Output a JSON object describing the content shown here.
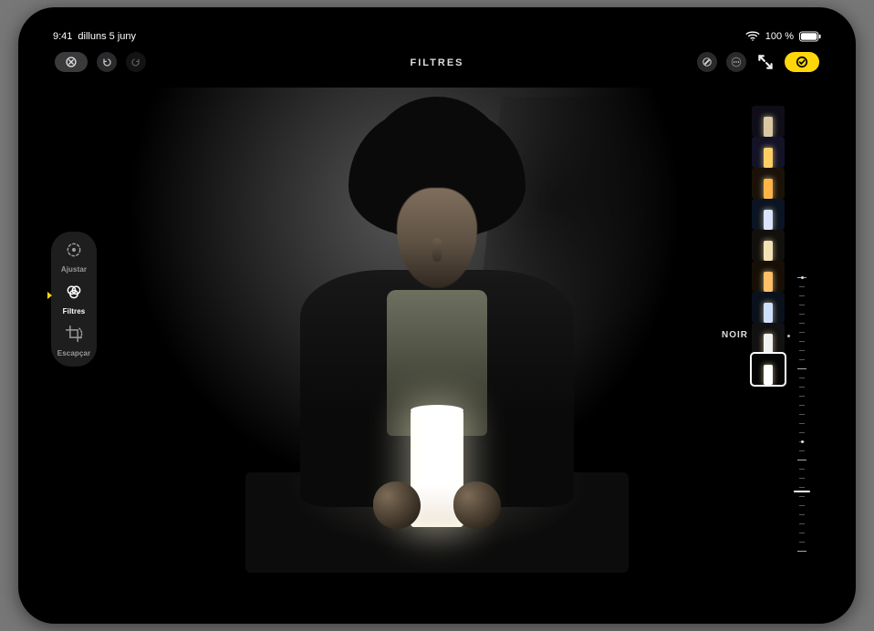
{
  "status": {
    "time": "9:41",
    "date": "dilluns 5 juny",
    "battery_text": "100 %"
  },
  "topbar": {
    "title": "FILTRES",
    "cancel_name": "cancel",
    "undo_name": "undo",
    "redo_name": "redo",
    "markup_name": "markup",
    "more_name": "more",
    "fullscreen_name": "fullscreen",
    "done_name": "done"
  },
  "modes": {
    "items": [
      {
        "label": "Ajustar",
        "name": "adjust"
      },
      {
        "label": "Filtres",
        "name": "filters"
      },
      {
        "label": "Escapçar",
        "name": "crop"
      }
    ],
    "active_index": 1
  },
  "filters": {
    "selected_label": "NOIR",
    "selected_index": 8,
    "items": [
      {
        "name": "original",
        "bg": "#0f0e18",
        "candle": "#d9c8a3"
      },
      {
        "name": "vivid",
        "bg": "#141226",
        "candle": "#ffcf66"
      },
      {
        "name": "vivid-warm",
        "bg": "#1a1208",
        "candle": "#ffb547"
      },
      {
        "name": "vivid-cool",
        "bg": "#0b1422",
        "candle": "#dce4ff"
      },
      {
        "name": "dramatic",
        "bg": "#12100d",
        "candle": "#f2e2b5"
      },
      {
        "name": "dramatic-warm",
        "bg": "#170f06",
        "candle": "#ffbf66"
      },
      {
        "name": "dramatic-cool",
        "bg": "#0a111c",
        "candle": "#cfe0ff"
      },
      {
        "name": "mono",
        "bg": "#111111",
        "candle": "#f2f2f2"
      },
      {
        "name": "noir",
        "bg": "#050505",
        "candle": "#ffffff"
      }
    ]
  },
  "intensity": {
    "value": 22,
    "min": 0,
    "max": 100
  }
}
